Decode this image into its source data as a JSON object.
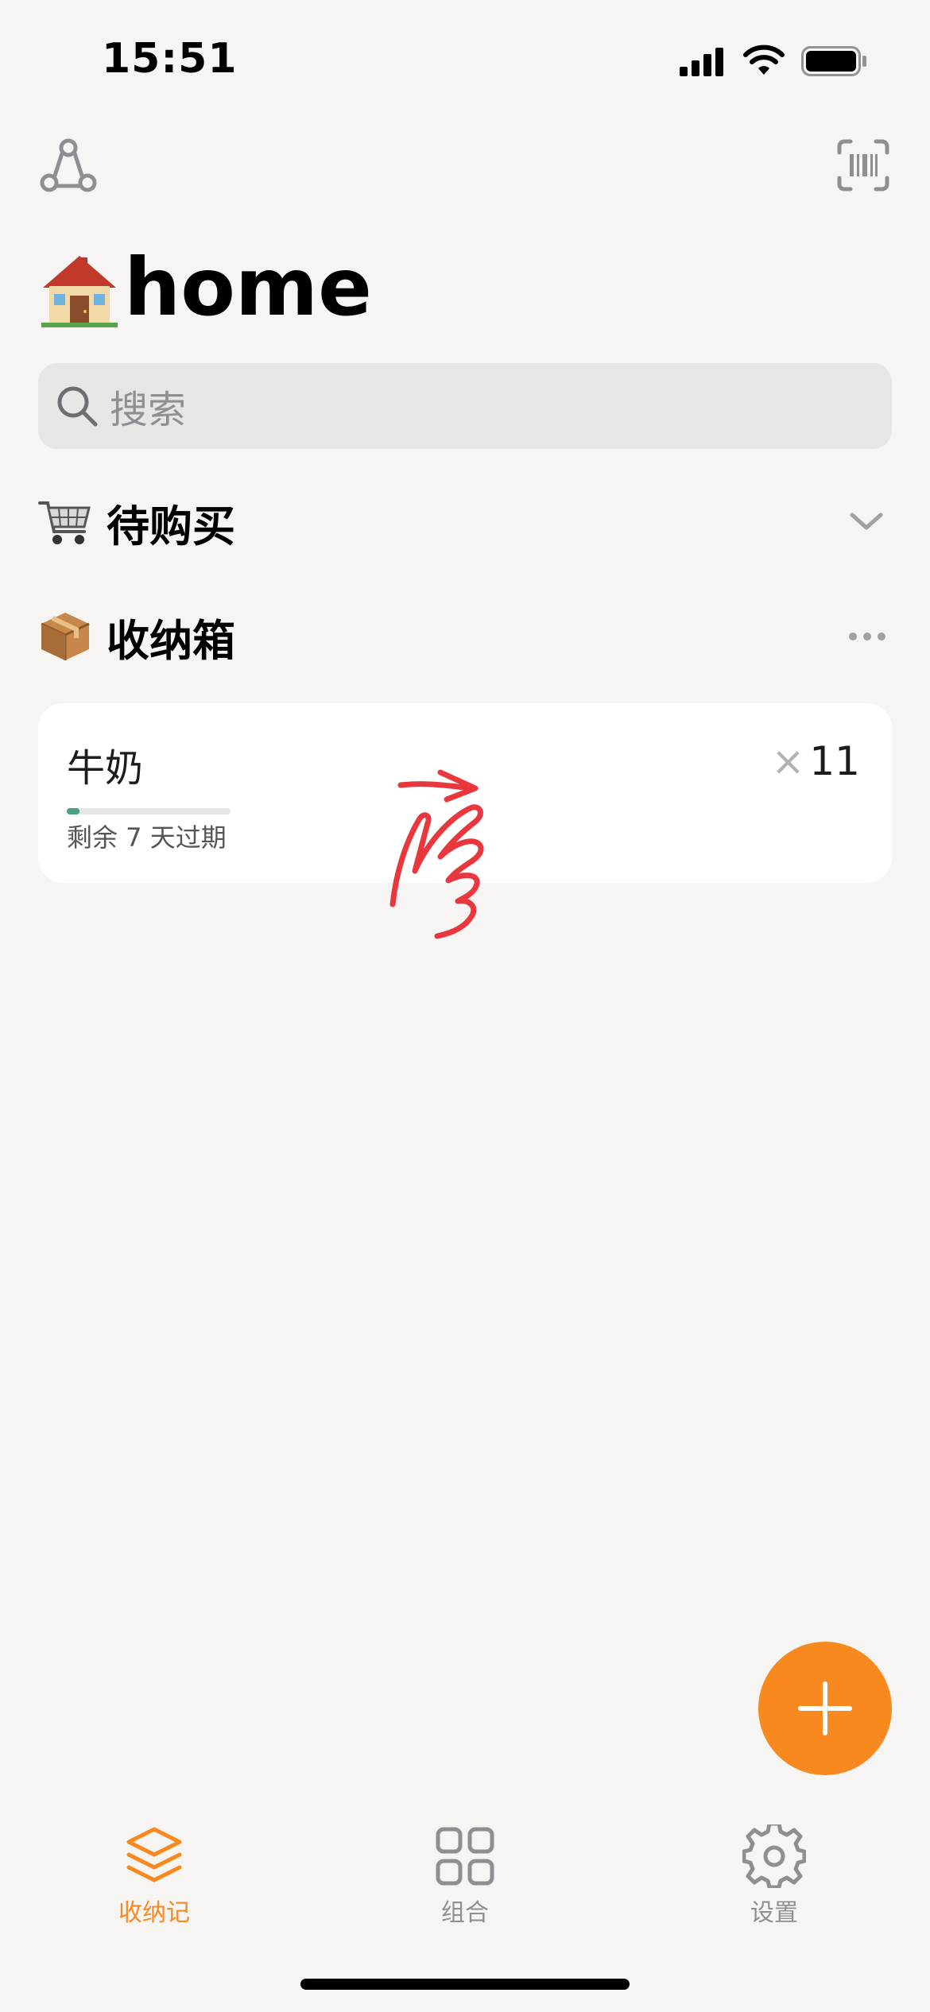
{
  "status_bar": {
    "time": "15:51",
    "battery_level": 1.0
  },
  "header": {
    "title": "home",
    "title_emoji": "house-emoji"
  },
  "search": {
    "placeholder": "搜索"
  },
  "sections": [
    {
      "emoji": "cart-emoji",
      "label": "待购买",
      "control": "chevron-down-icon"
    },
    {
      "emoji": "package-emoji",
      "label": "收纳箱",
      "control": "more-icon"
    }
  ],
  "item": {
    "name": "牛奶",
    "quantity_prefix": "×",
    "quantity": "11",
    "expiry_text": "剩余 7 天过期",
    "freshness_progress": 0.08
  },
  "tabs": [
    {
      "label": "收纳记",
      "icon": "layers-icon",
      "active": true
    },
    {
      "label": "组合",
      "icon": "grid-icon",
      "active": false
    },
    {
      "label": "设置",
      "icon": "gear-icon",
      "active": false
    }
  ],
  "colors": {
    "accent": "#f7891f",
    "background": "#f6f5f3",
    "progress": "#4a9e86",
    "inactive": "#8e8e93"
  }
}
